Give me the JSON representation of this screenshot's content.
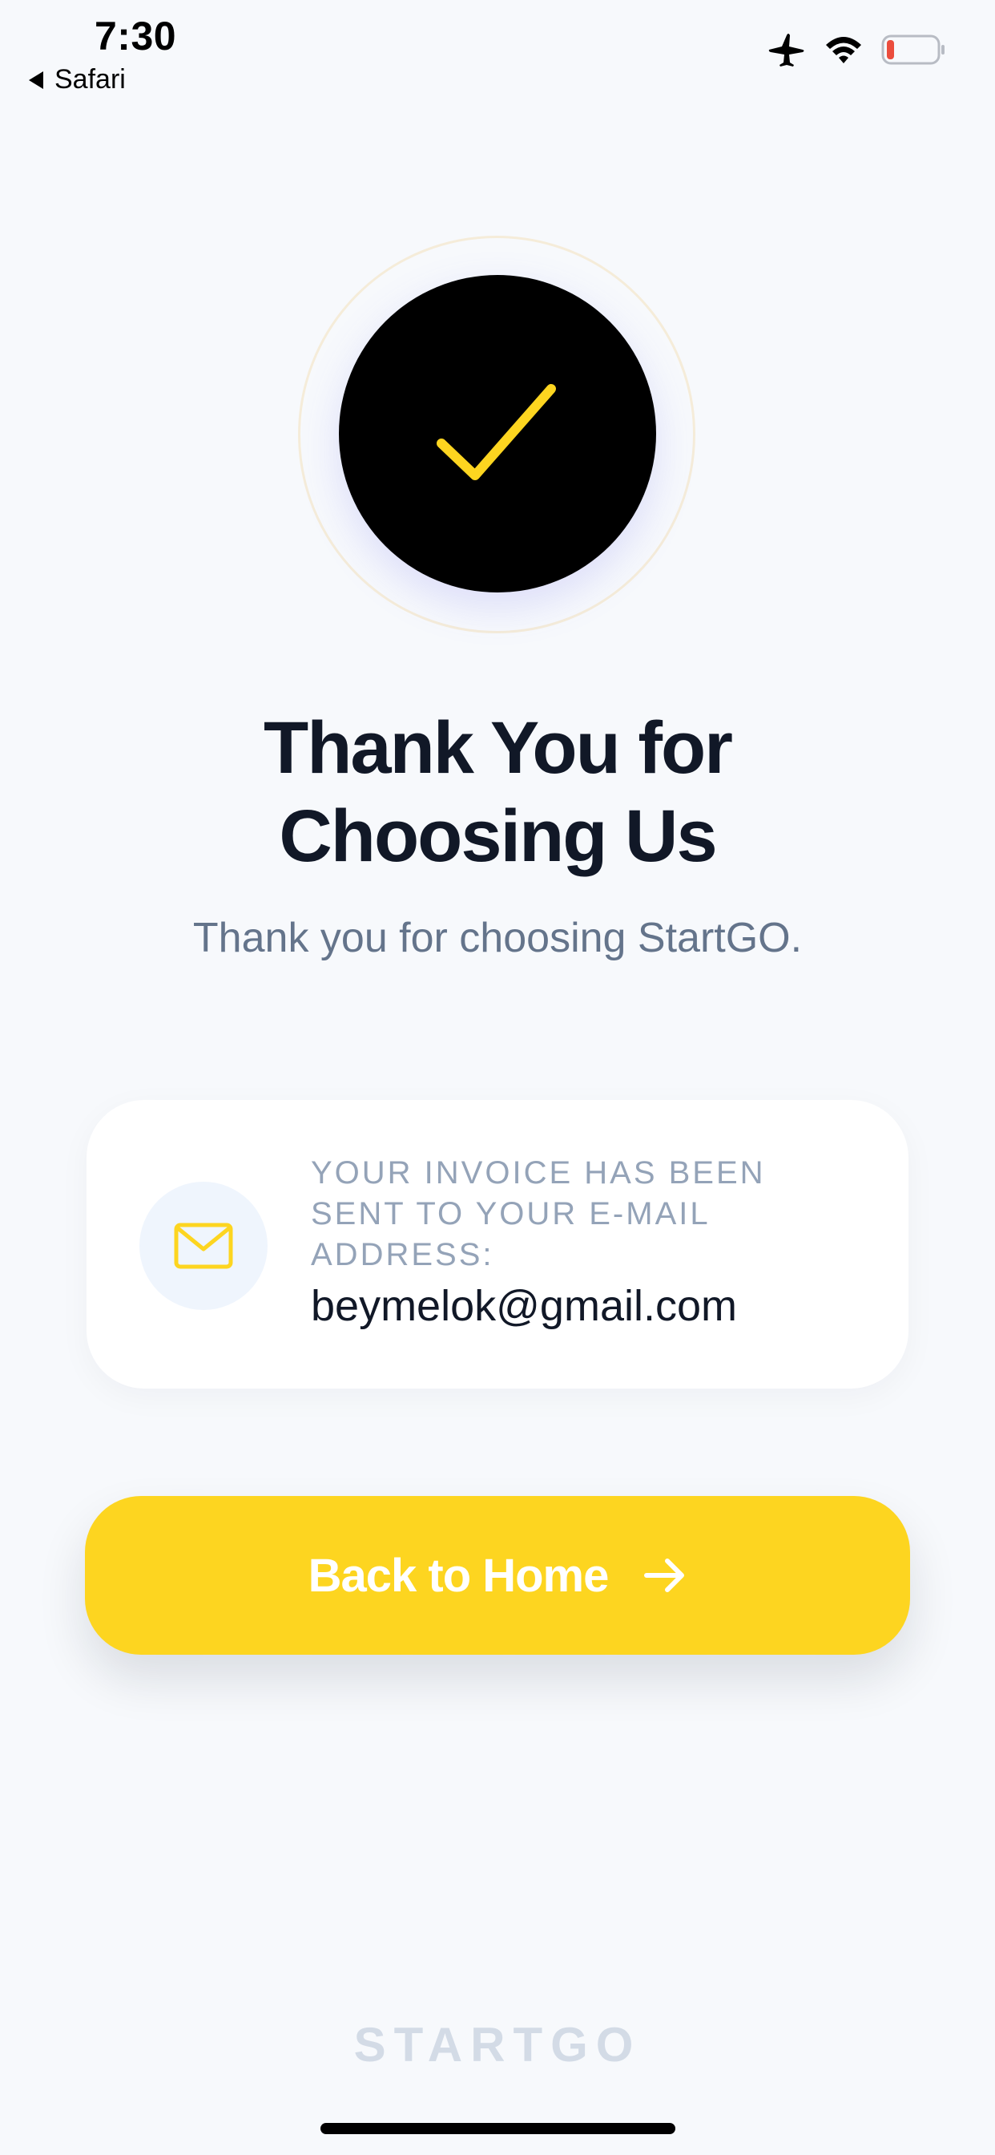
{
  "status_bar": {
    "time": "7:30",
    "back_app_label": "Safari",
    "icons": [
      "airplane-icon",
      "wifi-icon",
      "battery-low-icon"
    ]
  },
  "hero": {
    "icon": "checkmark-icon",
    "circle_color": "#000000",
    "check_color": "#fdd520"
  },
  "title_line1": "Thank You for",
  "title_line2": "Choosing Us",
  "subtitle": "Thank you for choosing StartGO.",
  "invoice": {
    "icon": "mail-icon",
    "note": "YOUR INVOICE HAS BEEN SENT TO YOUR E-MAIL ADDRESS:",
    "email": "beymelok@gmail.com"
  },
  "home_button": {
    "label": "Back to Home",
    "icon": "arrow-right-icon",
    "color": "#fdd520"
  },
  "brand": "STARTGO",
  "colors": {
    "accent": "#fdd520",
    "title": "#111827",
    "muted": "#64748b"
  }
}
